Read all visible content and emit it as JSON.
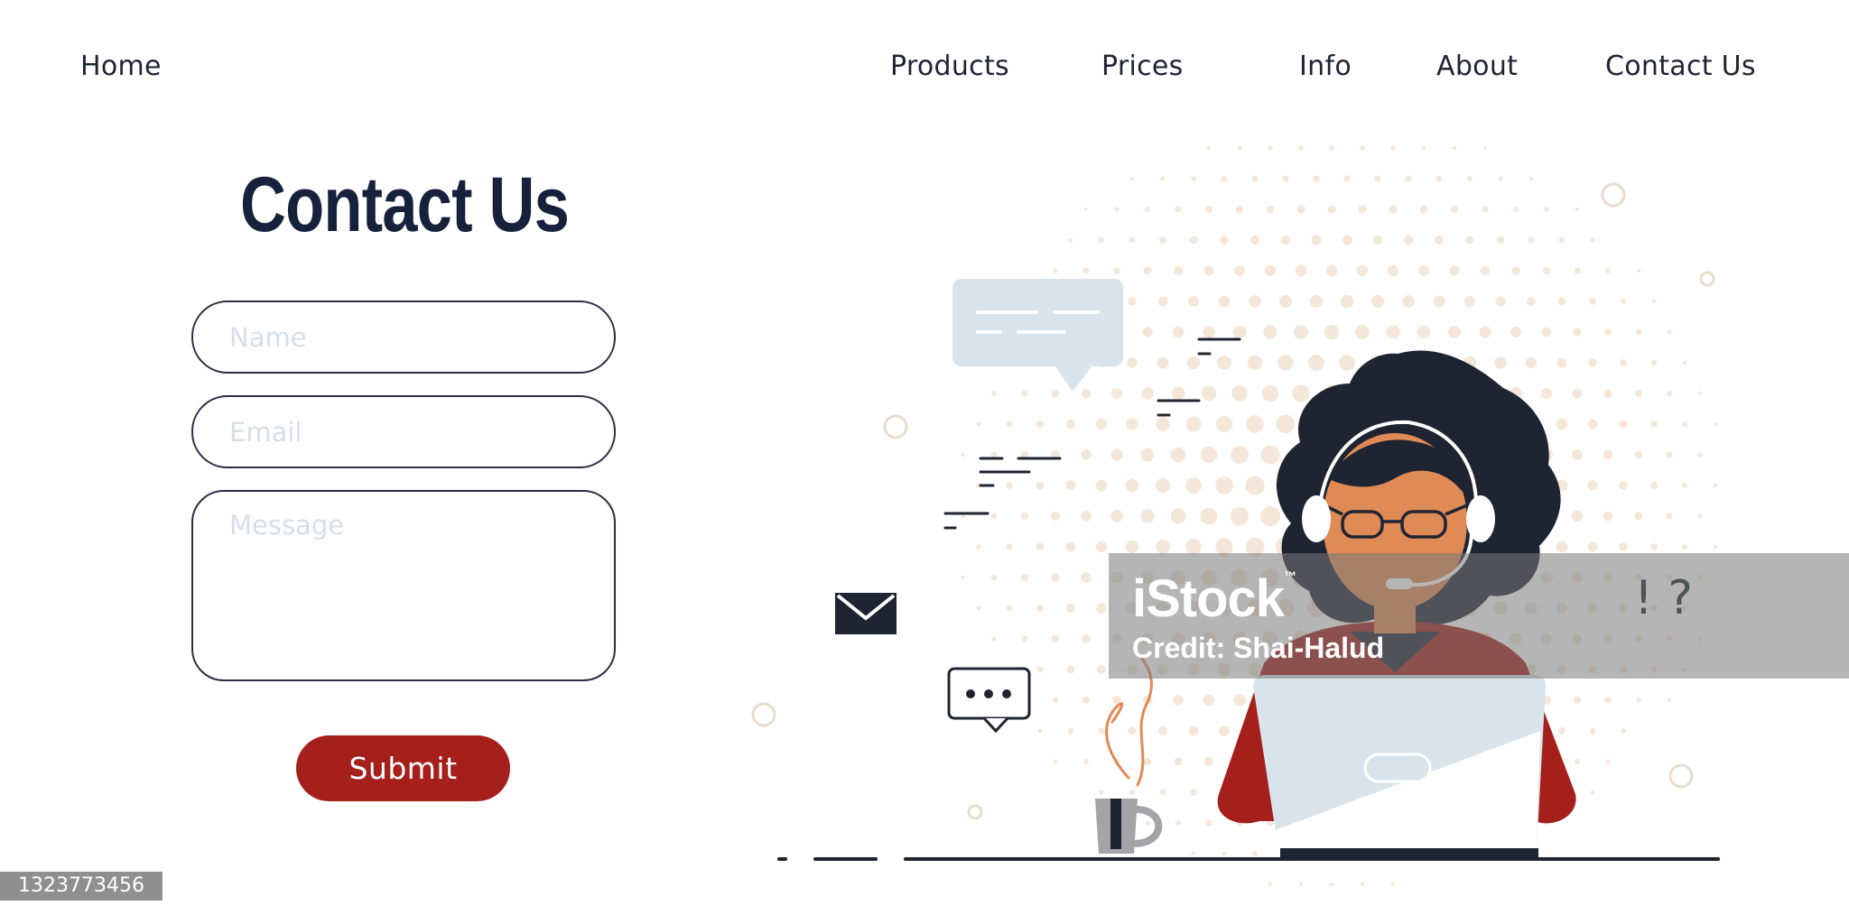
{
  "nav": {
    "home": "Home",
    "products": "Products",
    "prices": "Prices",
    "info": "Info",
    "about": "About",
    "contact": "Contact Us"
  },
  "form": {
    "title": "Contact Us",
    "name_placeholder": "Name",
    "email_placeholder": "Email",
    "message_placeholder": "Message",
    "submit_label": "Submit"
  },
  "illustration": {
    "punctuation": "! ?"
  },
  "watermark": {
    "logo": "iStock",
    "trademark": "™",
    "credit": "Credit: Shai-Halud",
    "stock_id": "1323773456"
  },
  "colors": {
    "accent": "#a51f1b",
    "navy": "#16213b",
    "bubble": "#d9e3ec",
    "dots": "#f4e7d9",
    "skin": "#e08a55"
  }
}
